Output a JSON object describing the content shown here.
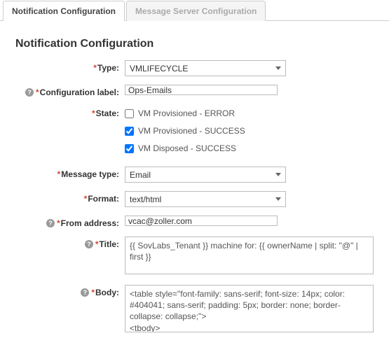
{
  "tabs": {
    "active": "Notification Configuration",
    "inactive": "Message Server Configuration"
  },
  "section_title": "Notification Configuration",
  "labels": {
    "type": "Type:",
    "config_label": "Configuration label:",
    "state": "State:",
    "message_type": "Message type:",
    "format": "Format:",
    "from_address": "From address:",
    "title": "Title:",
    "body": "Body:"
  },
  "values": {
    "type": "VMLIFECYCLE",
    "config_label": "Ops-Emails",
    "message_type": "Email",
    "format": "text/html",
    "from_address": "vcac@zoller.com",
    "title": "{{ SovLabs_Tenant }} machine for: {{ ownerName | split: \"@\" | first }}",
    "body": "<table style=\"font-family: sans-serif; font-size: 14px; color: #404041; sans-serif; padding: 5px; border: none; border-collapse: collapse;\">\n<tbody>\n"
  },
  "state_options": [
    {
      "label": "VM Provisioned - ERROR",
      "checked": false
    },
    {
      "label": "VM Provisioned - SUCCESS",
      "checked": true
    },
    {
      "label": "VM Disposed - SUCCESS",
      "checked": true
    }
  ]
}
